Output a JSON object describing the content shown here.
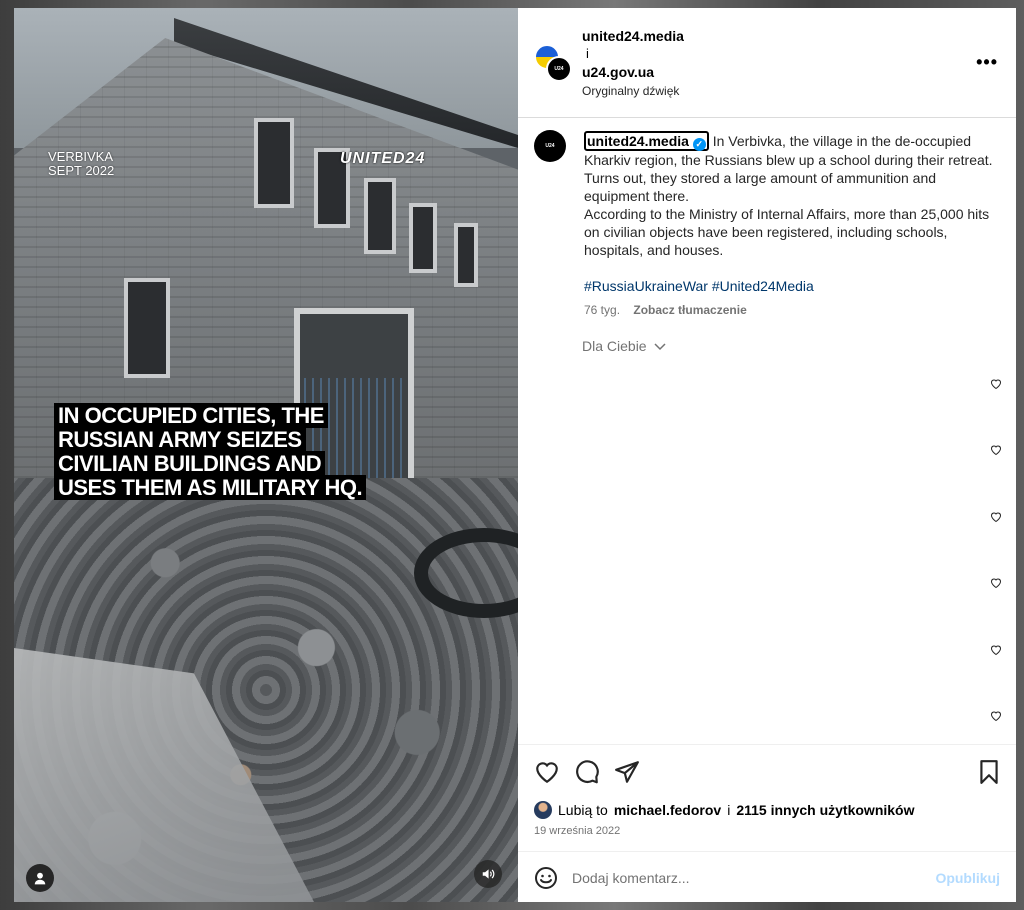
{
  "media": {
    "location_line1": "VERBIVKA",
    "location_line2": "SEPT 2022",
    "brand": "UNITED24",
    "headline": "IN OCCUPIED CITIES, THE RUSSIAN ARMY SEIZES CIVILIAN BUILDINGS AND USES THEM AS MILITARY HQ."
  },
  "header": {
    "user1": "united24.media",
    "and": "i",
    "user2": "u24.gov.ua",
    "audio": "Oryginalny dźwięk",
    "more": "•••"
  },
  "caption": {
    "username": "united24.media",
    "verified_mark": "✓",
    "text": "In Verbivka, the village in the de-occupied Kharkiv region, the Russians blew up a school during their retreat. Turns out, they stored a large amount of ammunition and equipment there.",
    "text2": "According to the Ministry of Internal Affairs, more than 25,000 hits on civilian objects have been registered, including schools, hospitals, and houses.",
    "hashtags": "#RussiaUkraineWar #United24Media",
    "age": "76 tyg.",
    "translate": "Zobacz tłumaczenie",
    "for_you": "Dla Ciebie"
  },
  "likes": {
    "prefix": "Lubią to",
    "user": "michael.fedorov",
    "joiner": "i",
    "others": "2115 innych użytkowników"
  },
  "date": "19 września 2022",
  "comment": {
    "placeholder": "Dodaj komentarz...",
    "publish": "Opublikuj"
  },
  "colors": {
    "link": "#00376b",
    "verified": "#0095f6",
    "publish_disabled": "#b3dbff"
  }
}
